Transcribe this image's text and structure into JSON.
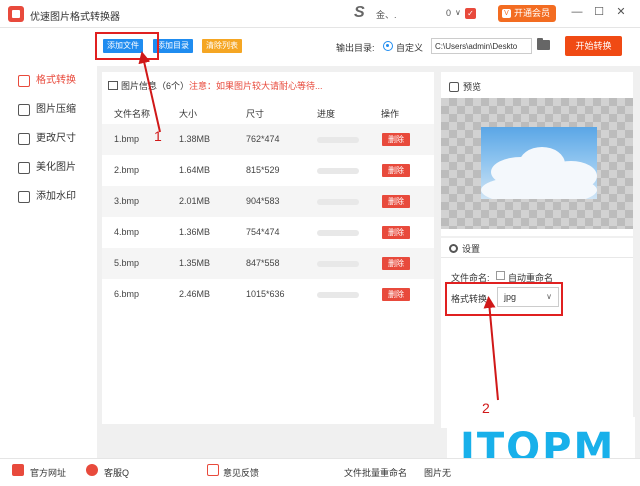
{
  "app": {
    "title": "优速图片格式转换器",
    "user_name": "金、.",
    "msg_count": "0",
    "vip_label": "开通会员"
  },
  "sidebar": {
    "items": [
      {
        "label": "格式转换"
      },
      {
        "label": "图片压缩"
      },
      {
        "label": "更改尺寸"
      },
      {
        "label": "美化图片"
      },
      {
        "label": "添加水印"
      }
    ]
  },
  "toolbar": {
    "add_file": "添加文件",
    "add_dir": "添加目录",
    "clear_list": "清除列表",
    "output_label": "输出目录:",
    "custom_label": "自定义",
    "output_path": "C:\\Users\\admin\\Deskto",
    "start_label": "开始转换"
  },
  "file_panel": {
    "title": "图片信息（6个）",
    "warning": "注意：如果图片较大请耐心等待...",
    "columns": [
      "文件名称",
      "大小",
      "尺寸",
      "进度",
      "操作"
    ],
    "delete_label": "删除",
    "rows": [
      {
        "name": "1.bmp",
        "size": "1.38MB",
        "dim": "762*474",
        "progress": 0
      },
      {
        "name": "2.bmp",
        "size": "1.64MB",
        "dim": "815*529",
        "progress": 0
      },
      {
        "name": "3.bmp",
        "size": "2.01MB",
        "dim": "904*583",
        "progress": 0
      },
      {
        "name": "4.bmp",
        "size": "1.36MB",
        "dim": "754*474",
        "progress": 0
      },
      {
        "name": "5.bmp",
        "size": "1.35MB",
        "dim": "847*558",
        "progress": 0
      },
      {
        "name": "6.bmp",
        "size": "2.46MB",
        "dim": "1015*636",
        "progress": 0
      }
    ]
  },
  "preview": {
    "title": "预览"
  },
  "settings": {
    "title": "设置",
    "naming_label": "文件命名:",
    "auto_rename": "自动重命名",
    "format_label": "格式转换:",
    "format_value": "jpg"
  },
  "annotations": {
    "one": "1",
    "two": "2"
  },
  "watermark": {
    "text": "ITOPM"
  },
  "footer": {
    "website": "官方网址",
    "service": "客服Q",
    "feedback": "意见反馈",
    "batch_rename": "文件批量重命名",
    "image_more": "图片无"
  },
  "colors": {
    "accent": "#e84a3c",
    "blue": "#1f8cf0",
    "orange": "#f5a623",
    "start": "#f04a14"
  }
}
